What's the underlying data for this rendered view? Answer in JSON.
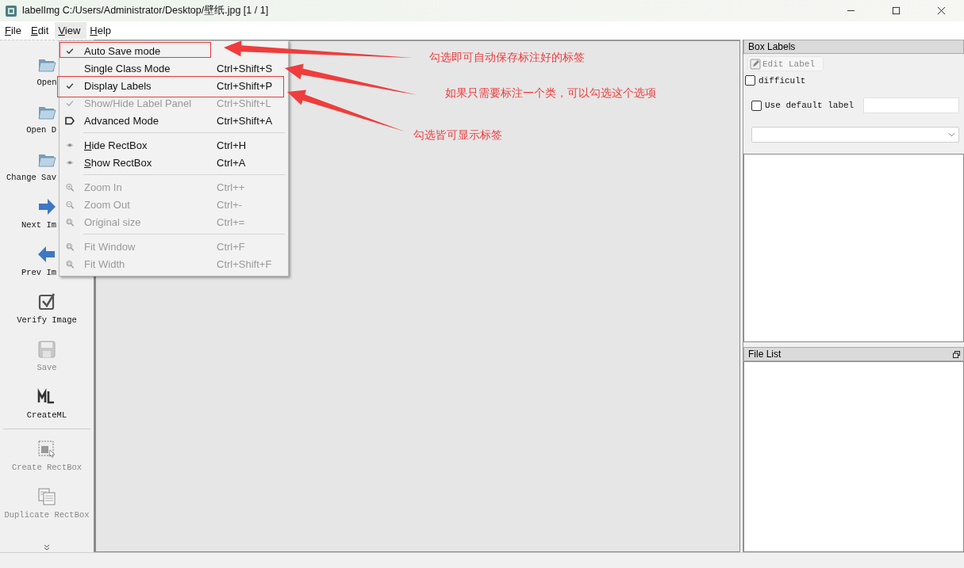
{
  "window": {
    "title": "labelImg C:/Users/Administrator/Desktop/壁纸.jpg [1 / 1]"
  },
  "menubar": [
    {
      "label": "File",
      "selected": false
    },
    {
      "label": "Edit",
      "selected": false
    },
    {
      "label": "View",
      "selected": true
    },
    {
      "label": "Help",
      "selected": false
    }
  ],
  "toolbar": [
    [
      {
        "label": "Open",
        "kind": "folder",
        "disabled": false
      },
      {
        "label": "Open D",
        "kind": "folder",
        "disabled": false
      },
      {
        "label": "Change Sav",
        "kind": "folder",
        "disabled": false
      },
      {
        "label": "Next Im",
        "kind": "next",
        "disabled": false
      },
      {
        "label": "Prev Im",
        "kind": "prev",
        "disabled": false
      },
      {
        "label": "Verify Image",
        "kind": "verify",
        "disabled": false
      },
      {
        "label": "Save",
        "kind": "save",
        "disabled": true
      },
      {
        "label": "CreateML",
        "kind": "ml",
        "disabled": false
      }
    ],
    [
      {
        "label": "Create RectBox",
        "kind": "rect",
        "disabled": true
      },
      {
        "label": "Duplicate RectBox",
        "kind": "duplicate",
        "disabled": true
      }
    ]
  ],
  "view_menu": [
    [
      {
        "label": "Auto Save mode",
        "kind": "check",
        "checked": true,
        "disabled": false
      },
      {
        "label": "Single Class Mode",
        "shortcut": "Ctrl+Shift+S",
        "kind": "check",
        "checked": false,
        "disabled": false
      },
      {
        "label": "Display Labels",
        "shortcut": "Ctrl+Shift+P",
        "kind": "check",
        "checked": true,
        "disabled": false
      },
      {
        "label": "Show/Hide Label Panel",
        "shortcut": "Ctrl+Shift+L",
        "kind": "check",
        "checked": true,
        "disabled": true
      },
      {
        "label": "Advanced Mode",
        "shortcut": "Ctrl+Shift+A",
        "kind": "tag",
        "disabled": false
      }
    ],
    [
      {
        "label": "Hide RectBox",
        "shortcut": "Ctrl+H",
        "kind": "eye",
        "disabled": false
      },
      {
        "label": "Show RectBox",
        "shortcut": "Ctrl+A",
        "kind": "eye",
        "disabled": false
      }
    ],
    [
      {
        "label": "Zoom In",
        "shortcut": "Ctrl++",
        "kind": "zoom-in",
        "disabled": true
      },
      {
        "label": "Zoom Out",
        "shortcut": "Ctrl+-",
        "kind": "zoom-out",
        "disabled": true
      },
      {
        "label": "Original size",
        "shortcut": "Ctrl+=",
        "kind": "zoom-fit",
        "disabled": true
      }
    ],
    [
      {
        "label": "Fit Window",
        "shortcut": "Ctrl+F",
        "kind": "zoom-fit",
        "disabled": true
      },
      {
        "label": "Fit Width",
        "shortcut": "Ctrl+Shift+F",
        "kind": "zoom-fit",
        "disabled": true
      }
    ]
  ],
  "callouts": [
    "勾选即可自动保存标注好的标签",
    "如果只需要标注一个类，可以勾选这个选项",
    "勾选皆可显示标签"
  ],
  "box_labels": {
    "title": "Box Labels",
    "edit_button": "Edit Label",
    "difficult": {
      "label": "difficult",
      "checked": false
    },
    "default_label": {
      "label": "Use default label",
      "checked": false
    }
  },
  "file_list": {
    "title": "File List"
  }
}
